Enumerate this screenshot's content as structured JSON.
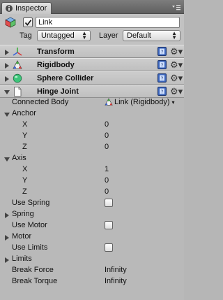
{
  "window": {
    "tab_label": "Inspector",
    "tab_icon": "info-icon",
    "menu_icon": "panel-menu-icon"
  },
  "object": {
    "name": "Link",
    "active": true,
    "tag_label": "Tag",
    "tag_value": "Untagged",
    "layer_label": "Layer",
    "layer_value": "Default",
    "icon": "cube-icon"
  },
  "components": [
    {
      "title": "Transform",
      "icon": "transform-axes-icon",
      "expanded": false
    },
    {
      "title": "Rigidbody",
      "icon": "rigidbody-icon",
      "expanded": false
    },
    {
      "title": "Sphere Collider",
      "icon": "sphere-collider-icon",
      "expanded": false,
      "enabled": true
    },
    {
      "title": "Hinge Joint",
      "icon": "script-document-icon",
      "expanded": true
    }
  ],
  "hinge": {
    "connected_body_label": "Connected Body",
    "connected_body_value": "Link (Rigidbody)",
    "anchor_label": "Anchor",
    "anchor": {
      "x_label": "X",
      "x": "0",
      "y_label": "Y",
      "y": "0",
      "z_label": "Z",
      "z": "0"
    },
    "axis_label": "Axis",
    "axis": {
      "x_label": "X",
      "x": "1",
      "y_label": "Y",
      "y": "0",
      "z_label": "Z",
      "z": "0"
    },
    "use_spring_label": "Use Spring",
    "use_spring": false,
    "spring_label": "Spring",
    "use_motor_label": "Use Motor",
    "use_motor": false,
    "motor_label": "Motor",
    "use_limits_label": "Use Limits",
    "use_limits": false,
    "limits_label": "Limits",
    "break_force_label": "Break Force",
    "break_force": "Infinity",
    "break_torque_label": "Break Torque",
    "break_torque": "Infinity"
  },
  "colors": {
    "background": "#b9b9b9",
    "header": "#c6c6c6",
    "help_blue": "#3a63b8",
    "collider_green": "#3cc57a"
  }
}
